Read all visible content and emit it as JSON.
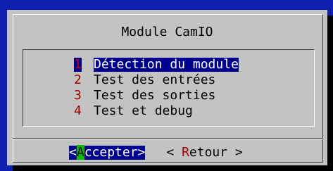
{
  "dialog": {
    "title": "Module CamIO"
  },
  "menu": {
    "items": [
      {
        "key": "1",
        "label": "Détection du module",
        "selected": true
      },
      {
        "key": "2",
        "label": "Test des entrées",
        "selected": false
      },
      {
        "key": "3",
        "label": "Test des sorties",
        "selected": false
      },
      {
        "key": "4",
        "label": "Test et debug",
        "selected": false
      }
    ]
  },
  "buttons": {
    "accept": {
      "prefix": "<",
      "hot": "A",
      "rest": "ccepter",
      "suffix": ">"
    },
    "retour": {
      "prefix": "< ",
      "hot": "R",
      "rest": "etour",
      "suffix": " >"
    }
  },
  "colors": {
    "background": "#0f1fb0",
    "dialog": "#c3c3c3",
    "selection": "#000090",
    "hotkey": "#a00000",
    "accept_hotkey_bg": "#00c000"
  }
}
